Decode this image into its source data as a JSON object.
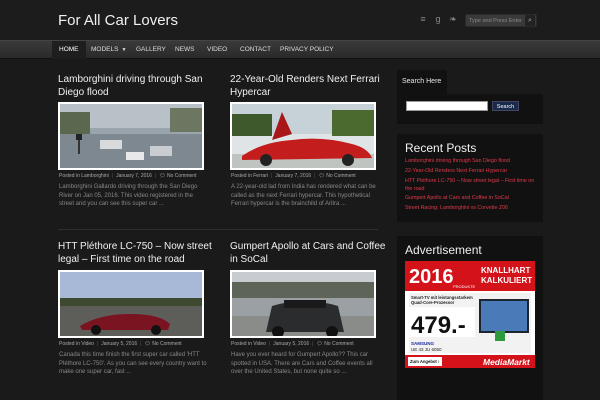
{
  "site": {
    "title": "For All Car Lovers"
  },
  "header": {
    "search_placeholder": "Type and Press Enter"
  },
  "nav": [
    {
      "label": "HOME"
    },
    {
      "label": "MODELS"
    },
    {
      "label": "GALLERY"
    },
    {
      "label": "NEWS"
    },
    {
      "label": "VIDEO"
    },
    {
      "label": "CONTACT"
    },
    {
      "label": "PRIVACY POLICY"
    }
  ],
  "posts": [
    {
      "title": "Lamborghini driving through San Diego flood",
      "category": "Lamborghini",
      "date": "January 7, 2016",
      "comments": "No Comment",
      "excerpt": "Lamborghini Gallardo driving through the San Diego River on Jan 05, 2016. This video registered in the street and you can see this super car ..."
    },
    {
      "title": "22-Year-Old Renders Next Ferrari Hypercar",
      "category": "Ferrari",
      "date": "January 7, 2016",
      "comments": "No Comment",
      "excerpt": "A 22-year-old lad from India has rendered what can be called as the next Ferrari hypercar. This hypothetical Ferrari hypercar is the brainchild of Aritra ..."
    },
    {
      "title": "HTT Pléthore LC-750 – Now street legal – First time on the road",
      "category": "Video",
      "date": "January 5, 2016",
      "comments": "No Comment",
      "excerpt": "Canada this time finish the first super car called 'HTT Pléthore LC-750'. As you can see every country want to make one super car, fast ..."
    },
    {
      "title": "Gumpert Apollo at Cars and Coffee in SoCal",
      "category": "Video",
      "date": "January 5, 2016",
      "comments": "No Comment",
      "excerpt": "Have you ever heard for Gumpert Apollo?? This car spotted in USA. There are Cars and Coffee events all over the United States, but none quite so ..."
    }
  ],
  "meta_prefix": "Posted in",
  "sidebar": {
    "search_tab": "Search Here",
    "search_button": "Search",
    "recent_title": "Recent Posts",
    "recent": [
      "Lamborghini driving through San Diego flood",
      "22-Year-Old Renders Next Ferrari Hypercar",
      "HTT Pléthore LC-750 – Now street legal – First time on the road",
      "Gumpert Apollo at Cars and Coffee in SoCal",
      "Street Racing: Lamborghini vs Corvette Z06"
    ],
    "ad_title": "Advertisement",
    "ad": {
      "year": "2016",
      "year_sub": "PRODUKTE",
      "slogan_1": "KNALLHART",
      "slogan_2": "KALKULIERT",
      "tv_line_1": "Smart-TV mit leistungsstarkem",
      "tv_line_2": "Quad-Core-Prozessor",
      "price": "479.-",
      "brand": "SAMSUNG",
      "model": "UE 43 JU 6050",
      "cta": "Zum Angebot ›",
      "store": "MediaMarkt"
    }
  },
  "colors": {
    "accent": "#e2384a",
    "background": "#1a1a1a",
    "nav": "#333333"
  }
}
